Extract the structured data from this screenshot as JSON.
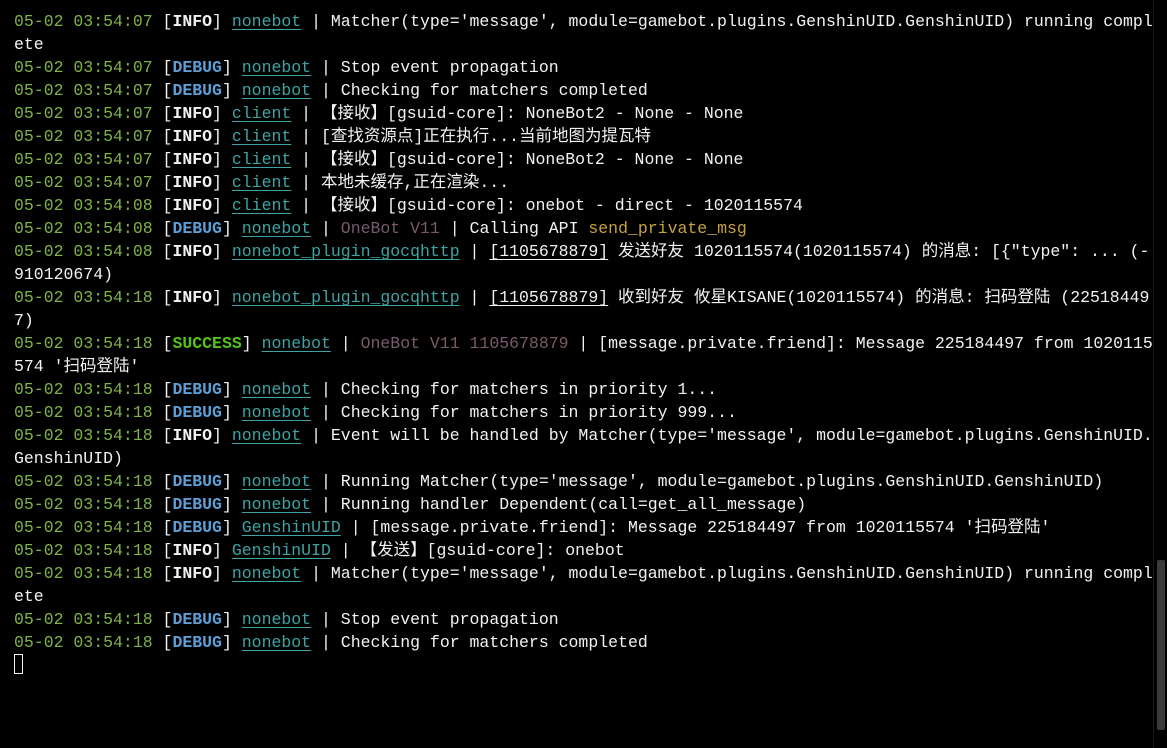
{
  "window": {
    "kind": "terminal-console"
  },
  "colors": {
    "background": "#000000",
    "text": "#f2f2f2",
    "timestamp": "#7fb347",
    "debug": "#5c9fd6",
    "success": "#52c41a",
    "module": "#3fa3a3",
    "adapter": "#7a5a6a",
    "api": "#c8a040"
  },
  "log_lines": [
    {
      "time": "05-02 03:54:07",
      "level": "INFO",
      "module": "nonebot",
      "segments": [
        {
          "kind": "msg",
          "text": "Matcher(type='message', module=gamebot.plugins.GenshinUID.GenshinUID) running complete"
        }
      ]
    },
    {
      "time": "05-02 03:54:07",
      "level": "DEBUG",
      "module": "nonebot",
      "segments": [
        {
          "kind": "msg",
          "text": "Stop event propagation"
        }
      ]
    },
    {
      "time": "05-02 03:54:07",
      "level": "DEBUG",
      "module": "nonebot",
      "segments": [
        {
          "kind": "msg",
          "text": "Checking for matchers completed"
        }
      ]
    },
    {
      "time": "05-02 03:54:07",
      "level": "INFO",
      "module": "client",
      "segments": [
        {
          "kind": "msg",
          "text": "【接收】[gsuid-core]: NoneBot2 - None - None"
        }
      ]
    },
    {
      "time": "05-02 03:54:07",
      "level": "INFO",
      "module": "client",
      "segments": [
        {
          "kind": "msg",
          "text": "[查找资源点]正在执行...当前地图为提瓦特"
        }
      ]
    },
    {
      "time": "05-02 03:54:07",
      "level": "INFO",
      "module": "client",
      "segments": [
        {
          "kind": "msg",
          "text": "【接收】[gsuid-core]: NoneBot2 - None - None"
        }
      ]
    },
    {
      "time": "05-02 03:54:07",
      "level": "INFO",
      "module": "client",
      "segments": [
        {
          "kind": "msg",
          "text": "本地未缓存,正在渲染..."
        }
      ]
    },
    {
      "time": "05-02 03:54:08",
      "level": "INFO",
      "module": "client",
      "segments": [
        {
          "kind": "msg",
          "text": "【接收】[gsuid-core]: onebot - direct - 1020115574"
        }
      ]
    },
    {
      "time": "05-02 03:54:08",
      "level": "DEBUG",
      "module": "nonebot",
      "segments": [
        {
          "kind": "adapter",
          "text": "OneBot V11"
        },
        {
          "kind": "sep",
          "text": " | "
        },
        {
          "kind": "msg",
          "text": "Calling API "
        },
        {
          "kind": "api",
          "text": "send_private_msg"
        }
      ]
    },
    {
      "time": "05-02 03:54:08",
      "level": "INFO",
      "module": "nonebot_plugin_gocqhttp",
      "segments": [
        {
          "kind": "qq",
          "text": "[1105678879]"
        },
        {
          "kind": "msg",
          "text": " 发送好友 1020115574(1020115574) 的消息: [{\"type\": ... (-910120674)"
        }
      ]
    },
    {
      "time": "05-02 03:54:18",
      "level": "INFO",
      "module": "nonebot_plugin_gocqhttp",
      "segments": [
        {
          "kind": "qq",
          "text": "[1105678879]"
        },
        {
          "kind": "msg",
          "text": " 收到好友 攸星KISANE(1020115574) 的消息: 扫码登陆 (225184497)"
        }
      ]
    },
    {
      "time": "05-02 03:54:18",
      "level": "SUCCESS",
      "module": "nonebot",
      "segments": [
        {
          "kind": "adapter",
          "text": "OneBot V11 1105678879"
        },
        {
          "kind": "sep",
          "text": " | "
        },
        {
          "kind": "msg",
          "text": "[message.private.friend]: Message 225184497 from 1020115574 '扫码登陆'"
        }
      ]
    },
    {
      "time": "05-02 03:54:18",
      "level": "DEBUG",
      "module": "nonebot",
      "segments": [
        {
          "kind": "msg",
          "text": "Checking for matchers in priority 1..."
        }
      ]
    },
    {
      "time": "05-02 03:54:18",
      "level": "DEBUG",
      "module": "nonebot",
      "segments": [
        {
          "kind": "msg",
          "text": "Checking for matchers in priority 999..."
        }
      ]
    },
    {
      "time": "05-02 03:54:18",
      "level": "INFO",
      "module": "nonebot",
      "segments": [
        {
          "kind": "msg",
          "text": "Event will be handled by Matcher(type='message', module=gamebot.plugins.GenshinUID.GenshinUID)"
        }
      ]
    },
    {
      "time": "05-02 03:54:18",
      "level": "DEBUG",
      "module": "nonebot",
      "segments": [
        {
          "kind": "msg",
          "text": "Running Matcher(type='message', module=gamebot.plugins.GenshinUID.GenshinUID)"
        }
      ]
    },
    {
      "time": "05-02 03:54:18",
      "level": "DEBUG",
      "module": "nonebot",
      "segments": [
        {
          "kind": "msg",
          "text": "Running handler Dependent(call=get_all_message)"
        }
      ]
    },
    {
      "time": "05-02 03:54:18",
      "level": "DEBUG",
      "module": "GenshinUID",
      "segments": [
        {
          "kind": "msg",
          "text": "[message.private.friend]: Message 225184497 from 1020115574 '扫码登陆'"
        }
      ]
    },
    {
      "time": "05-02 03:54:18",
      "level": "INFO",
      "module": "GenshinUID",
      "segments": [
        {
          "kind": "msg",
          "text": "【发送】[gsuid-core]: onebot"
        }
      ]
    },
    {
      "time": "05-02 03:54:18",
      "level": "INFO",
      "module": "nonebot",
      "segments": [
        {
          "kind": "msg",
          "text": "Matcher(type='message', module=gamebot.plugins.GenshinUID.GenshinUID) running complete"
        }
      ]
    },
    {
      "time": "05-02 03:54:18",
      "level": "DEBUG",
      "module": "nonebot",
      "segments": [
        {
          "kind": "msg",
          "text": "Stop event propagation"
        }
      ]
    },
    {
      "time": "05-02 03:54:18",
      "level": "DEBUG",
      "module": "nonebot",
      "segments": [
        {
          "kind": "msg",
          "text": "Checking for matchers completed"
        }
      ]
    }
  ]
}
